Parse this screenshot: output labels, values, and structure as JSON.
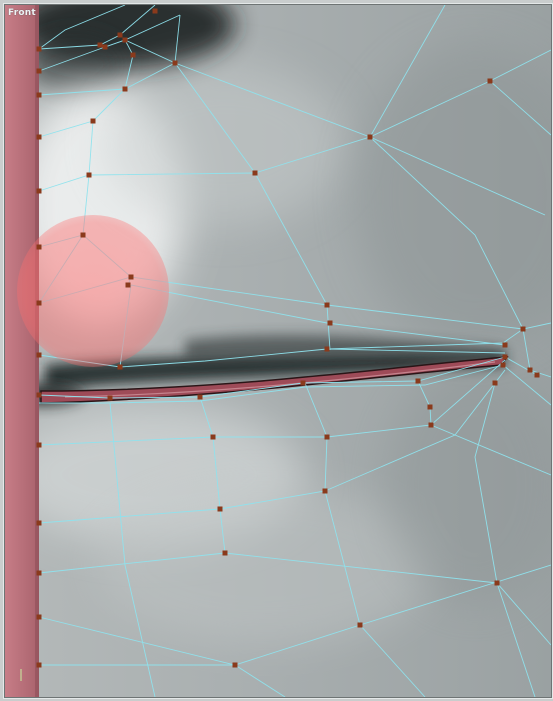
{
  "viewport": {
    "label": "Front"
  },
  "colors": {
    "wire": "#8fe3ee",
    "vertex": "#8a3a1c",
    "brush": "#ff6e6e",
    "lip_inner": "#9e4b58",
    "skin_edge": "#b86d78"
  },
  "icons": {
    "brush": "soft-selection-brush",
    "vertex": "vertex-marker"
  }
}
